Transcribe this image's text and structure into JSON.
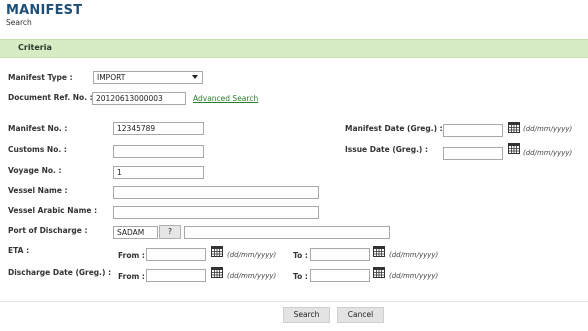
{
  "header": {
    "title": "MANIFEST",
    "subtitle": "Search"
  },
  "criteria": {
    "label": "Criteria"
  },
  "form": {
    "manifest_type": {
      "label": "Manifest Type :",
      "value": "IMPORT"
    },
    "doc_ref": {
      "label": "Document Ref. No. :",
      "value": "20120613000003",
      "advanced_link": "Advanced Search"
    },
    "manifest_no": {
      "label": "Manifest No. :",
      "value": "12345789"
    },
    "manifest_date": {
      "label": "Manifest Date (Greg.) :",
      "value": "",
      "hint": "(dd/mm/yyyy)"
    },
    "customs_no": {
      "label": "Customs No. :",
      "value": ""
    },
    "issue_date": {
      "label": "Issue Date (Greg.) :",
      "value": "",
      "hint": "(dd/mm/yyyy)"
    },
    "voyage_no": {
      "label": "Voyage No. :",
      "value": "1"
    },
    "vessel_name": {
      "label": "Vessel Name :",
      "value": ""
    },
    "vessel_arabic_name": {
      "label": "Vessel Arabic Name :",
      "value": ""
    },
    "port_of_discharge": {
      "label": "Port of Discharge :",
      "code": "SADAM",
      "lookup": "?",
      "name": ""
    },
    "eta": {
      "label": "ETA :",
      "from_label": "From :",
      "to_label": "To :",
      "from_value": "",
      "to_value": "",
      "hint": "(dd/mm/yyyy)"
    },
    "discharge_date": {
      "label": "Discharge Date (Greg.) :",
      "from_label": "From :",
      "to_label": "To :",
      "from_value": "",
      "to_value": "",
      "hint": "(dd/mm/yyyy)"
    }
  },
  "buttons": {
    "search": "Search",
    "cancel": "Cancel"
  }
}
